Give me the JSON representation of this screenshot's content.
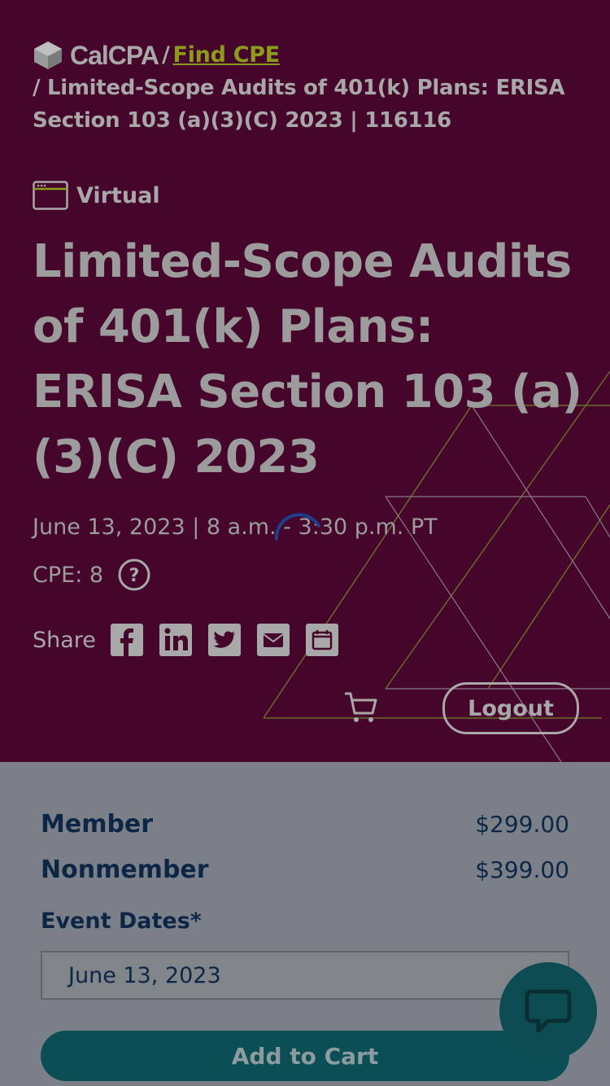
{
  "breadcrumb": {
    "logo": "CalCPA",
    "separator": "/",
    "find_cpe": "Find CPE",
    "current": "/ Limited-Scope Audits of 401(k) Plans: ERISA Section 103 (a)(3)(C) 2023 | 116116"
  },
  "event": {
    "format": "Virtual",
    "title": "Limited-Scope Audits of 401(k) Plans: ERISA Section 103 (a)(3)(C) 2023",
    "datetime": "June 13, 2023 | 8 a.m. - 3:30 p.m. PT",
    "cpe": "CPE: 8"
  },
  "share": {
    "label": "Share",
    "icons": [
      "facebook-icon",
      "linkedin-icon",
      "twitter-icon",
      "email-icon",
      "calendar-icon"
    ]
  },
  "header_actions": {
    "logout_label": "Logout"
  },
  "pricing": [
    {
      "name": "Member",
      "price": "$299.00"
    },
    {
      "name": "Nonmember",
      "price": "$399.00"
    }
  ],
  "event_dates": {
    "label": "Event Dates*",
    "selected": "June 13, 2023"
  },
  "add_to_cart_label": "Add to Cart",
  "colors": {
    "hero_bg": "#46052b",
    "accent": "#8b9b1c",
    "navy": "#0e2646",
    "teal": "#0c4e56"
  }
}
